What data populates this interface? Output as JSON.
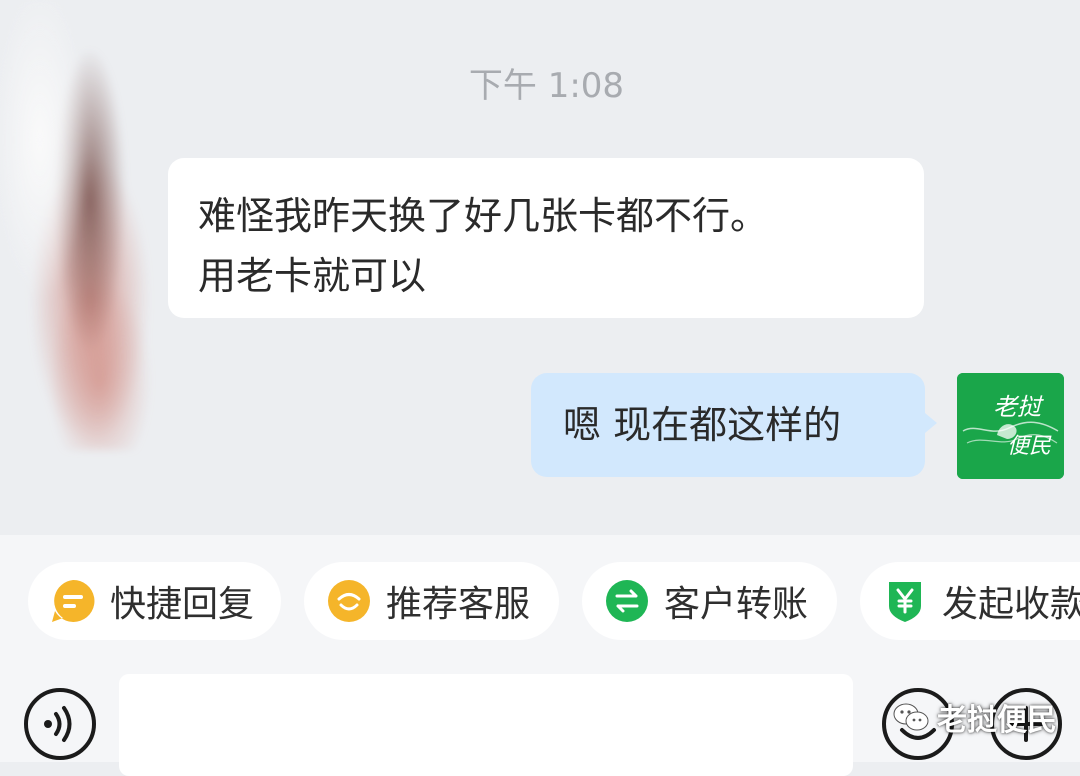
{
  "chat": {
    "timestamp": "下午 1:08",
    "incoming_message": {
      "line1": "难怪我昨天换了好几张卡都不行。",
      "line2": "用老卡就可以"
    },
    "outgoing_message": "嗯 现在都这样的",
    "avatar_text_top": "老挝",
    "avatar_text_bottom": "便民"
  },
  "quick_actions": [
    {
      "label": "快捷回复",
      "icon": "quick-reply-icon",
      "color": "#f5b52a"
    },
    {
      "label": "推荐客服",
      "icon": "recommend-service-icon",
      "color": "#f5b52a"
    },
    {
      "label": "客户转账",
      "icon": "transfer-icon",
      "color": "#1fb655"
    },
    {
      "label": "发起收款",
      "icon": "collect-payment-icon",
      "color": "#1fb655"
    }
  ],
  "input_bar": {
    "voice_icon": "voice-icon",
    "emoji_icon": "emoji-icon",
    "plus_icon": "plus-icon",
    "watermark": "老挝便民"
  },
  "colors": {
    "chat_background": "#eceef1",
    "outgoing_bubble": "#d2e8fd",
    "incoming_bubble": "#ffffff",
    "avatar_green": "#1aa64a"
  }
}
